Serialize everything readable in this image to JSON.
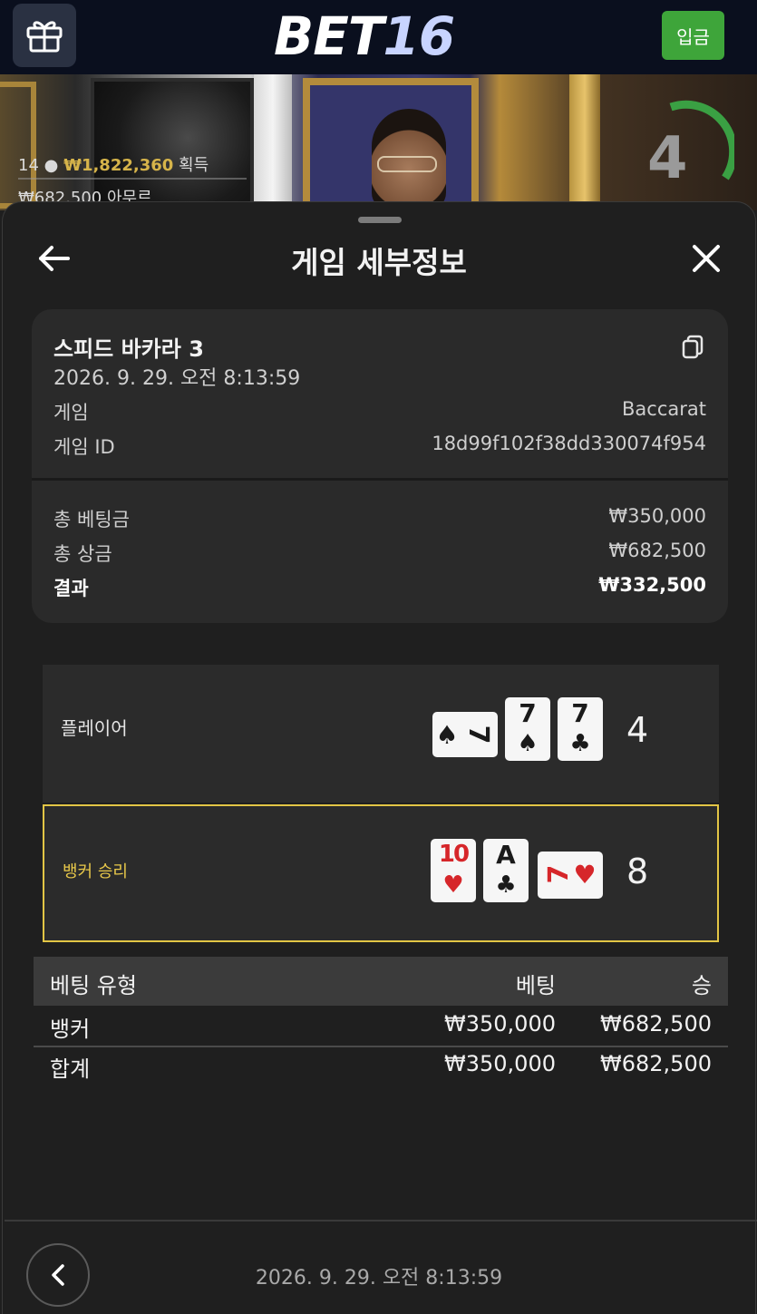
{
  "header": {
    "logo_text_main": "BET",
    "logo_text_num": "16",
    "deposit_label": "입금",
    "gift_icon": "gift-icon"
  },
  "video": {
    "players_count": "14",
    "winnings": "₩1,822,360",
    "winnings_suffix": "획득",
    "line2": "₩682,500  아무르",
    "timer": "4"
  },
  "sheet": {
    "title": "게임 세부정보"
  },
  "info": {
    "game_name": "스피드 바카라 3",
    "datetime": "2026. 9. 29. 오전 8:13:59",
    "game_label": "게임",
    "game_value": "Baccarat",
    "game_id_label": "게임 ID",
    "game_id_value": "18d99f102f38dd330074f954",
    "total_bet_label": "총 베팅금",
    "total_bet_value": "₩350,000",
    "total_win_label": "총 상금",
    "total_win_value": "₩682,500",
    "result_label": "결과",
    "result_value": "₩332,500"
  },
  "hands": {
    "player": {
      "label": "플레이어",
      "score": "4",
      "cards": [
        {
          "rank": "7",
          "suit": "♠",
          "color": "black",
          "rotated": true
        },
        {
          "rank": "7",
          "suit": "♠",
          "color": "black",
          "rotated": false
        },
        {
          "rank": "7",
          "suit": "♣",
          "color": "black",
          "rotated": false
        }
      ]
    },
    "banker": {
      "label": "뱅커 승리",
      "score": "8",
      "cards": [
        {
          "rank": "10",
          "suit": "♥",
          "color": "red",
          "rotated": false
        },
        {
          "rank": "A",
          "suit": "♣",
          "color": "black",
          "rotated": false
        },
        {
          "rank": "7",
          "suit": "♥",
          "color": "red",
          "rotated": true
        }
      ]
    }
  },
  "bets": {
    "headers": {
      "type": "베팅 유형",
      "bet": "베팅",
      "win": "승"
    },
    "rows": [
      {
        "type": "뱅커",
        "bet": "₩350,000",
        "win": "₩682,500"
      }
    ],
    "total": {
      "type": "합계",
      "bet": "₩350,000",
      "win": "₩682,500"
    }
  },
  "footer": {
    "datetime": "2026. 9. 29. 오전 8:13:59"
  },
  "colors": {
    "deposit_green": "#3ea53a",
    "banker_highlight": "#e2c545",
    "gold_text": "#d6b44a"
  }
}
